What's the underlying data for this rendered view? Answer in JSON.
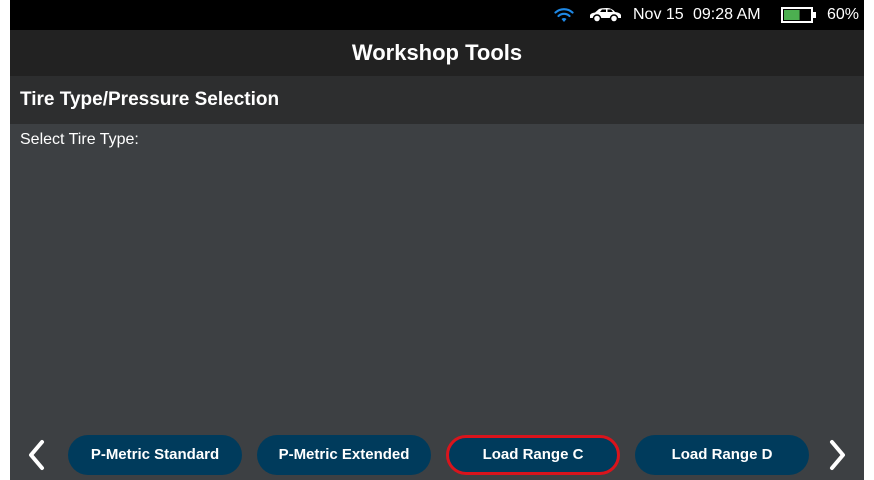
{
  "status_bar": {
    "wifi_icon": "wifi-icon",
    "car_icon": "car-icon",
    "date": "Nov 15",
    "time": "09:28 AM",
    "battery_icon": "battery-icon",
    "battery_percent": "60%",
    "battery_level": 0.6,
    "battery_color": "#4caf50",
    "wifi_color": "#1e88e5"
  },
  "title_bar": {
    "title": "Workshop Tools"
  },
  "section": {
    "title": "Tire Type/Pressure Selection"
  },
  "content": {
    "prompt": "Select Tire Type:"
  },
  "options": {
    "prev_icon": "chevron-left-icon",
    "next_icon": "chevron-right-icon",
    "items": [
      {
        "label": "P-Metric Standard",
        "selected": false
      },
      {
        "label": "P-Metric Extended",
        "selected": false
      },
      {
        "label": "Load Range C",
        "selected": true
      },
      {
        "label": "Load Range D",
        "selected": false
      }
    ],
    "selected_border_color": "#d9141c",
    "button_color": "#003b5c"
  }
}
